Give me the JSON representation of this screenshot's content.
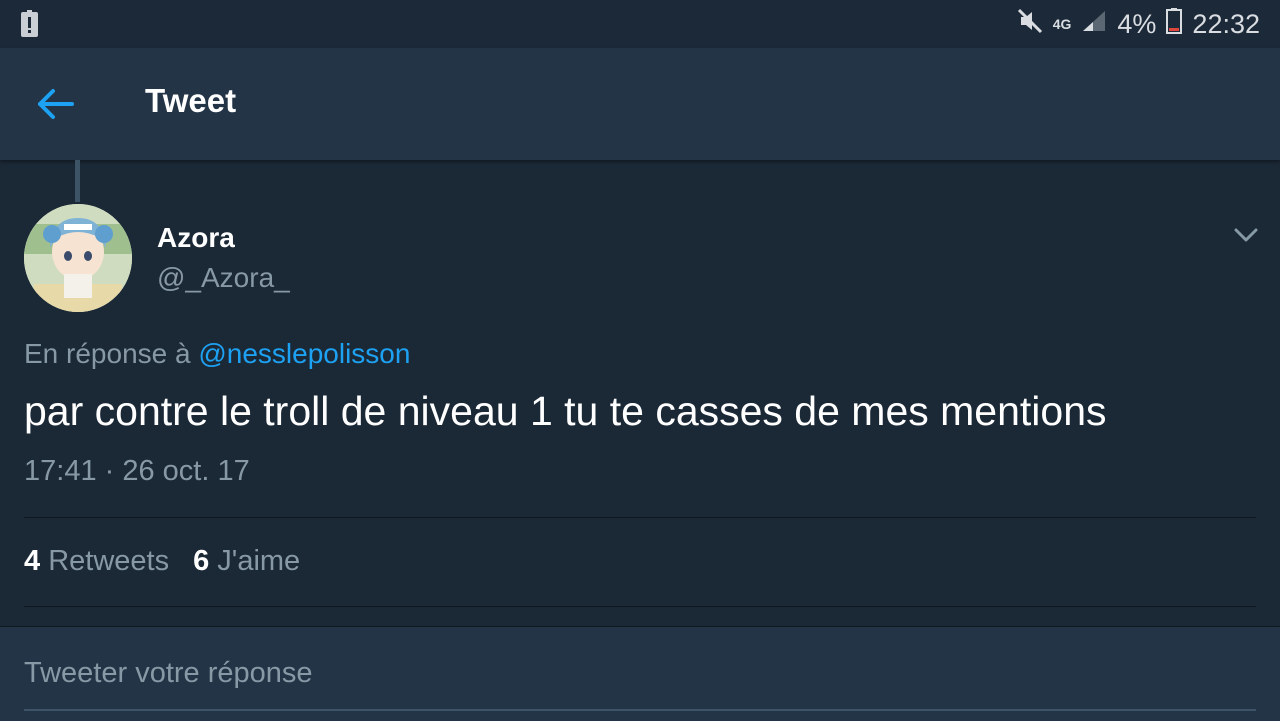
{
  "status_bar": {
    "network": "4G",
    "battery": "4%",
    "time": "22:32",
    "icons": [
      "alert-icon",
      "mute-icon",
      "signal-icon",
      "battery-icon"
    ]
  },
  "header": {
    "title": "Tweet"
  },
  "tweet": {
    "display_name": "Azora",
    "handle": "@_Azora_",
    "reply_prefix": "En réponse à ",
    "reply_mention": "@nesslepolisson",
    "text": "par contre le troll de niveau 1 tu te casses de mes mentions",
    "timestamp": "17:41 · 26 oct. 17"
  },
  "stats": {
    "retweets_count": "4",
    "retweets_label": "Retweets",
    "likes_count": "6",
    "likes_label": "J'aime"
  },
  "reply_box": {
    "placeholder": "Tweeter votre réponse"
  },
  "colors": {
    "background": "#1b2836",
    "header": "#243447",
    "accent": "#1da1f2",
    "secondary_text": "#8899a6"
  }
}
